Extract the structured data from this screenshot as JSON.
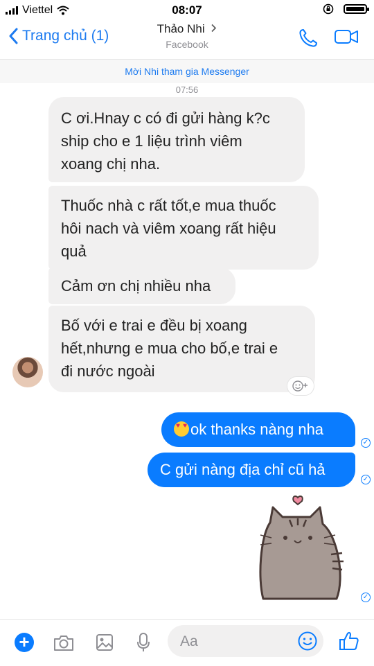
{
  "status_bar": {
    "carrier": "Viettel",
    "time": "08:07"
  },
  "header": {
    "back_label": "Trang chủ (1)",
    "contact_name": "Thảo Nhi",
    "contact_sub": "Facebook",
    "icons": [
      "back-chevron-icon",
      "chevron-right-icon",
      "phone-icon",
      "video-camera-icon"
    ]
  },
  "banner": {
    "invite_text": "Mời Nhi tham gia Messenger"
  },
  "conversation": {
    "timestamp": "07:56",
    "incoming": [
      {
        "lines": [
          "C ơi.Hnay c có đi gửi hàng k?c",
          "ship cho e 1 liệu trình viêm",
          "xoang chị nha."
        ]
      },
      {
        "lines": [
          "Thuốc nhà c rất tốt,e mua thuốc",
          "hôi nach và viêm xoang rất hiệu",
          "quả"
        ]
      },
      {
        "lines": [
          "Cảm ơn chị nhiều nha"
        ]
      },
      {
        "lines": [
          "Bố với e trai e đều bị xoang",
          "hết,nhưng e mua cho bố,e trai e",
          "đi nước ngoài"
        ]
      }
    ],
    "outgoing": [
      {
        "text": "ok thanks nàng nha",
        "emoji": "heart-eyes-emoji"
      },
      {
        "text": "C gửi nàng địa chỉ cũ hả"
      }
    ],
    "sticker": "pusheen-cat-heart-sticker"
  },
  "composer": {
    "placeholder": "Aa",
    "icons": [
      "plus-icon",
      "camera-icon",
      "image-icon",
      "microphone-icon",
      "emoji-icon",
      "thumbs-up-icon"
    ]
  },
  "colors": {
    "accent": "#0a7cff",
    "incoming_bubble": "#f1f0f0",
    "secondary_text": "#8e8e93"
  }
}
